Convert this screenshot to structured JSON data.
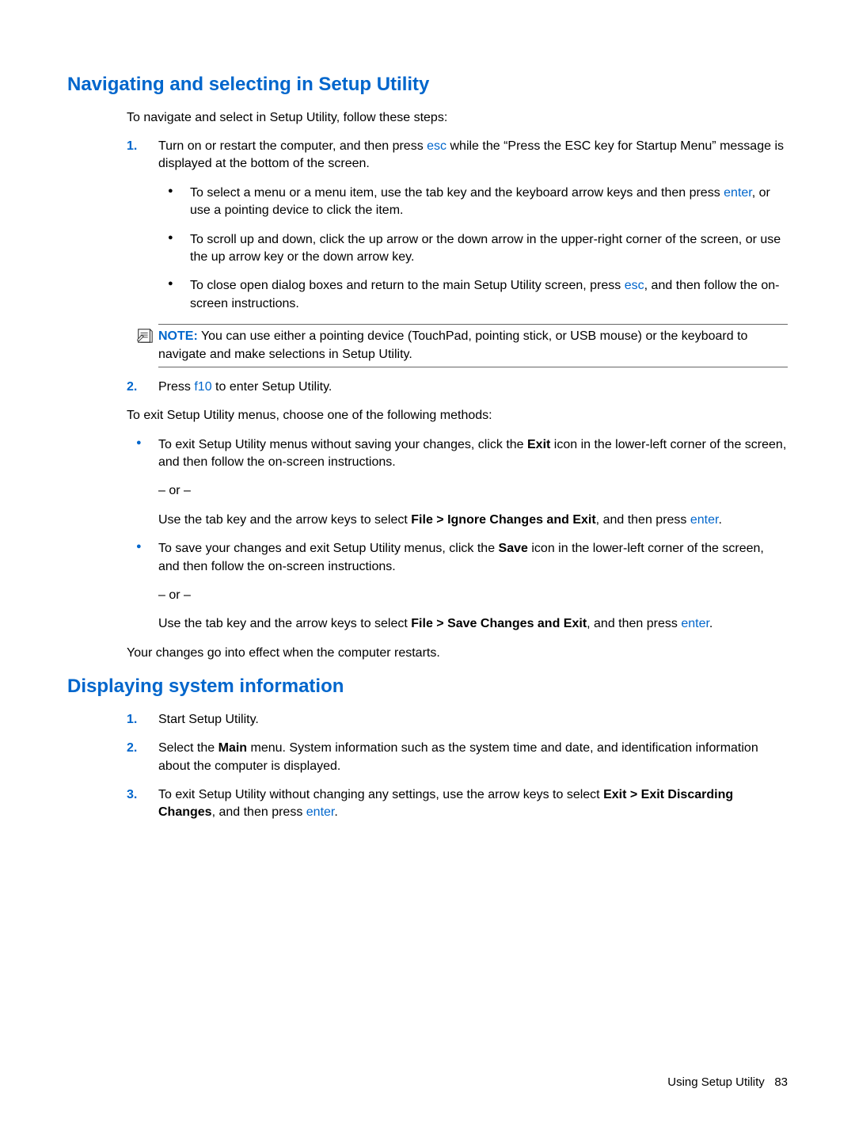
{
  "section1": {
    "heading": "Navigating and selecting in Setup Utility",
    "intro": "To navigate and select in Setup Utility, follow these steps:",
    "steps": [
      {
        "num": "1.",
        "text_a": "Turn on or restart the computer, and then press ",
        "key1": "esc",
        "text_b": " while the “Press the ESC key for Startup Menu” message is displayed at the bottom of the screen.",
        "bullets": [
          {
            "pre": "To select a menu or a menu item, use the tab key and the keyboard arrow keys and then press ",
            "key": "enter",
            "post": ", or use a pointing device to click the item."
          },
          {
            "pre": "To scroll up and down, click the up arrow or the down arrow in the upper-right corner of the screen, or use the up arrow key or the down arrow key.",
            "key": "",
            "post": ""
          },
          {
            "pre": "To close open dialog boxes and return to the main Setup Utility screen, press ",
            "key": "esc",
            "post": ", and then follow the on-screen instructions."
          }
        ],
        "note_label": "NOTE:",
        "note_text": "   You can use either a pointing device (TouchPad, pointing stick, or USB mouse) or the keyboard to navigate and make selections in Setup Utility."
      },
      {
        "num": "2.",
        "text_a": "Press ",
        "key1": "f10",
        "text_b": " to enter Setup Utility."
      }
    ],
    "exit_intro": "To exit Setup Utility menus, choose one of the following methods:",
    "exit_bullets": [
      {
        "line1_pre": "To exit Setup Utility menus without saving your changes, click the ",
        "line1_bold": "Exit",
        "line1_post": " icon in the lower-left corner of the screen, and then follow the on-screen instructions.",
        "or": "– or –",
        "line2_pre": "Use the tab key and the arrow keys to select ",
        "line2_bold": "File > Ignore Changes and Exit",
        "line2_mid": ", and then press ",
        "line2_key": "enter",
        "line2_post": "."
      },
      {
        "line1_pre": "To save your changes and exit Setup Utility menus, click the ",
        "line1_bold": "Save",
        "line1_post": " icon in the lower-left corner of the screen, and then follow the on-screen instructions.",
        "or": "– or –",
        "line2_pre": "Use the tab key and the arrow keys to select ",
        "line2_bold": "File > Save Changes and Exit",
        "line2_mid": ", and then press ",
        "line2_key": "enter",
        "line2_post": "."
      }
    ],
    "exit_outro": "Your changes go into effect when the computer restarts."
  },
  "section2": {
    "heading": "Displaying system information",
    "steps": [
      {
        "num": "1.",
        "text": "Start Setup Utility."
      },
      {
        "num": "2.",
        "pre": "Select the ",
        "bold": "Main",
        "post": " menu. System information such as the system time and date, and identification information about the computer is displayed."
      },
      {
        "num": "3.",
        "pre": "To exit Setup Utility without changing any settings, use the arrow keys to select ",
        "bold": "Exit > Exit Discarding Changes",
        "mid": ", and then press ",
        "key": "enter",
        "post": "."
      }
    ]
  },
  "footer": {
    "title": "Using Setup Utility",
    "pagenum": "83"
  }
}
